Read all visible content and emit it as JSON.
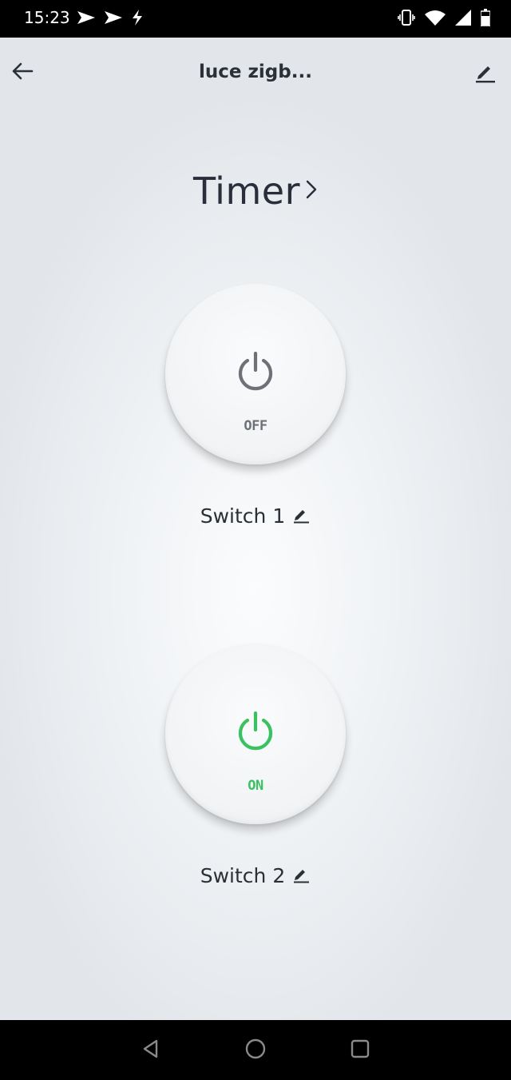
{
  "status_bar": {
    "time": "15:23",
    "left_icons": [
      "navigation-arrow-icon",
      "navigation-arrow-icon",
      "flash-icon"
    ],
    "right_icons": [
      "vibrate-icon",
      "wifi-icon",
      "cellular-signal-icon",
      "battery-icon"
    ]
  },
  "header": {
    "title": "luce zigb...",
    "back_icon": "arrow-left-icon",
    "edit_icon": "pencil-icon"
  },
  "timer": {
    "label": "Timer",
    "icon": "chevron-right-icon"
  },
  "switches": [
    {
      "name": "Switch 1",
      "state_label": "OFF",
      "on": false,
      "color": "#6e7177"
    },
    {
      "name": "Switch 2",
      "state_label": "ON",
      "on": true,
      "color": "#3ac262"
    }
  ],
  "nav_bar": {
    "buttons": [
      "back-triangle-icon",
      "home-circle-icon",
      "recents-square-icon"
    ]
  }
}
